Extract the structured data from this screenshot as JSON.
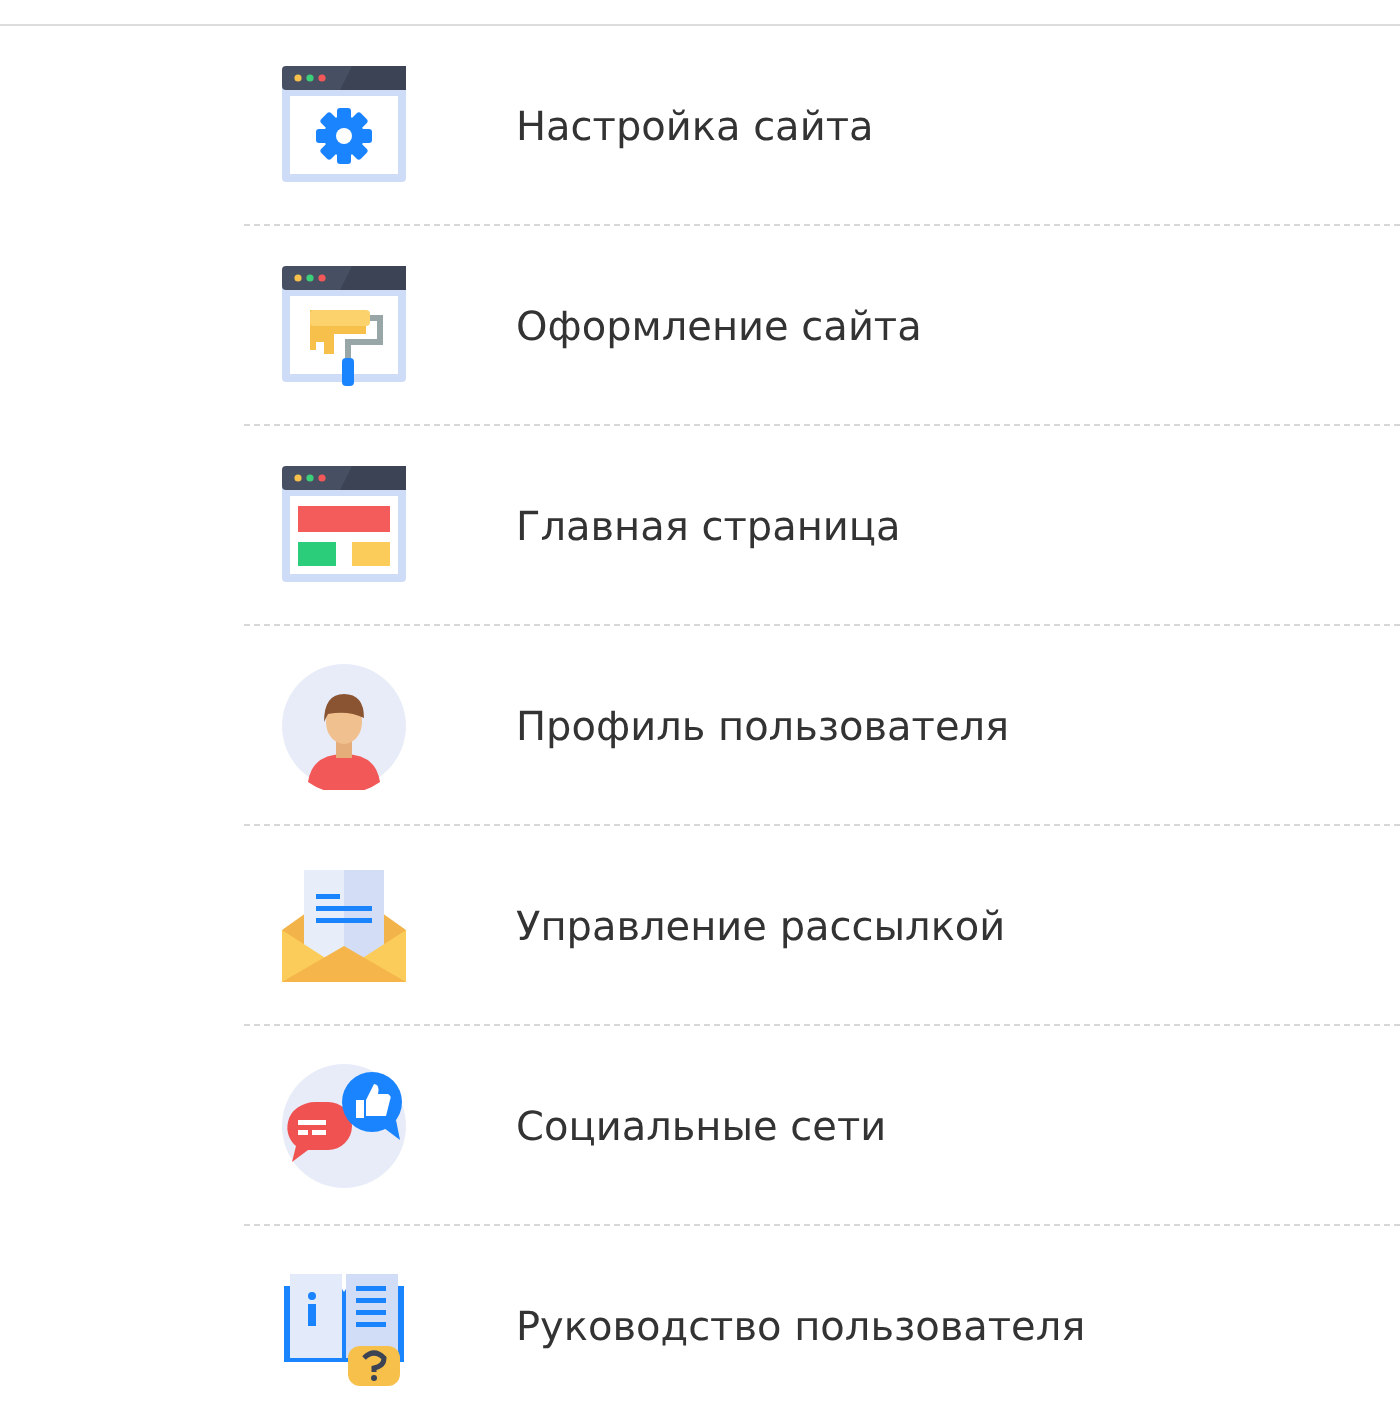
{
  "menu": [
    {
      "label": "Настройка сайта",
      "kind": "settings"
    },
    {
      "label": "Оформление сайта",
      "kind": "design"
    },
    {
      "label": "Главная страница",
      "kind": "homepage"
    },
    {
      "label": "Профиль пользователя",
      "kind": "profile"
    },
    {
      "label": "Управление рассылкой",
      "kind": "mail"
    },
    {
      "label": "Социальные сети",
      "kind": "social"
    },
    {
      "label": "Руководство пользователя",
      "kind": "guide"
    }
  ]
}
